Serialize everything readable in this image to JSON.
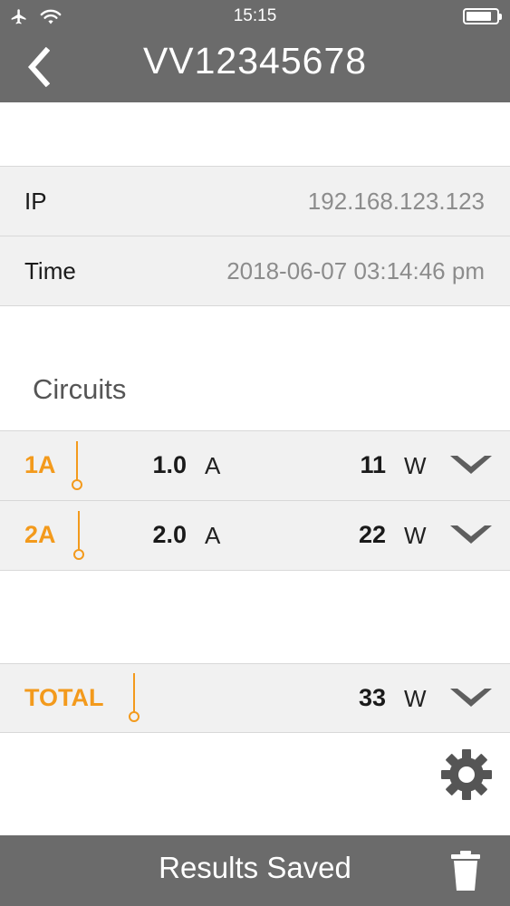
{
  "status_bar": {
    "time": "15:15",
    "battery_level": 0.85,
    "icons": [
      "airplane-icon",
      "wifi-icon",
      "battery-icon"
    ]
  },
  "header": {
    "title": "VV12345678",
    "back_icon": "chevron-left-icon"
  },
  "info": {
    "ip_label": "IP",
    "ip_value": "192.168.123.123",
    "time_label": "Time",
    "time_value": "2018-06-07 03:14:46 pm"
  },
  "circuits": {
    "title": "Circuits",
    "rows": [
      {
        "label": "1A",
        "amps": "1.0",
        "amps_unit": "A",
        "watts": "11",
        "watts_unit": "W"
      },
      {
        "label": "2A",
        "amps": "2.0",
        "amps_unit": "A",
        "watts": "22",
        "watts_unit": "W"
      }
    ]
  },
  "total": {
    "label": "TOTAL",
    "watts": "33",
    "watts_unit": "W"
  },
  "footer": {
    "label": "Results Saved",
    "trash_icon": "trash-icon"
  },
  "settings_icon": "gear-icon",
  "colors": {
    "header_bg": "#6b6b6b",
    "accent": "#f39a1c",
    "row_bg": "#f1f1f1",
    "muted_text": "#8c8c8c"
  }
}
